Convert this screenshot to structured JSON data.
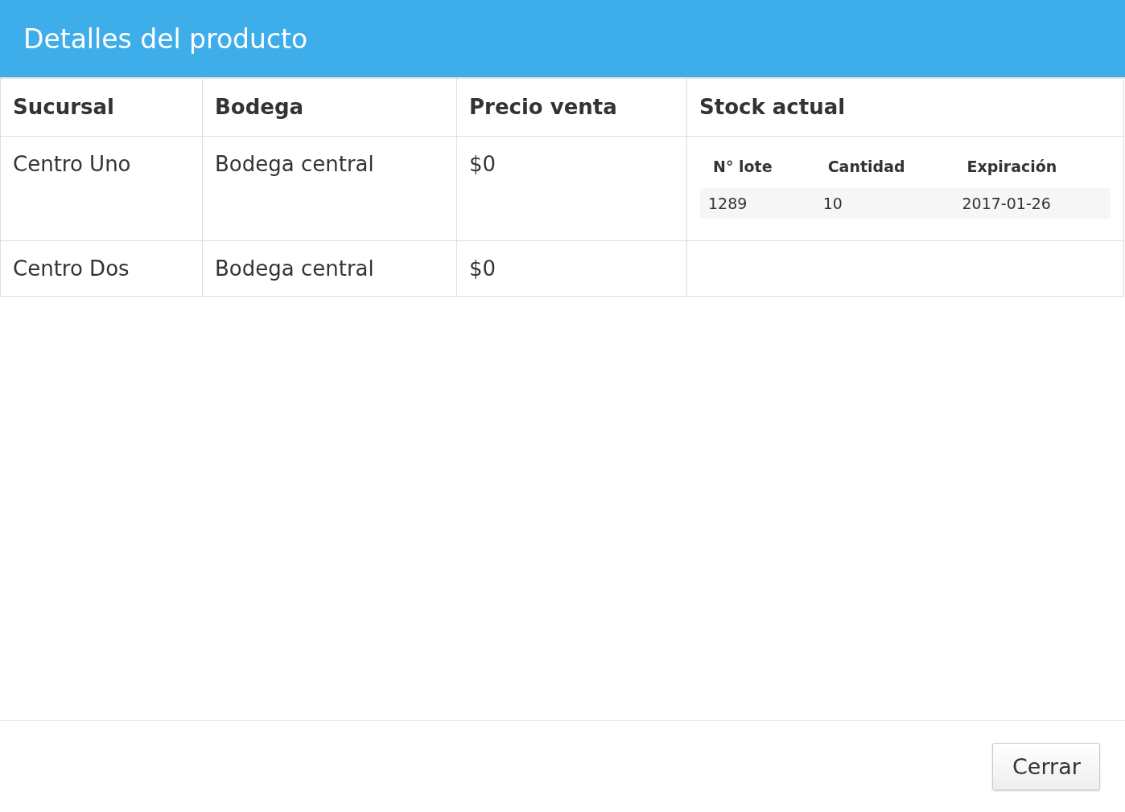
{
  "dialog": {
    "title": "Detalles del producto"
  },
  "table": {
    "columns": [
      "Sucursal",
      "Bodega",
      "Precio venta",
      "Stock actual"
    ],
    "rows": [
      {
        "cells": [
          "Centro Uno",
          "Bodega central",
          "$0"
        ],
        "stock": {
          "columns": [
            "N° lote",
            "Cantidad",
            "Expiración"
          ],
          "rows": [
            [
              "1289",
              "10",
              "2017-01-26"
            ]
          ]
        }
      },
      {
        "cells": [
          "Centro Dos",
          "Bodega central",
          "$0"
        ]
      }
    ]
  },
  "footer": {
    "buttons": [
      "Cerrar"
    ]
  }
}
